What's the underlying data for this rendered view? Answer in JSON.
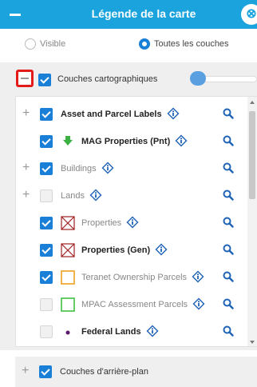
{
  "header": {
    "title": "Légende de la carte",
    "close_label": "⊗"
  },
  "radios": [
    {
      "label": "Visible",
      "selected": false
    },
    {
      "label": "Toutes les couches",
      "selected": true
    }
  ],
  "main_group": {
    "label": "Couches cartographiques",
    "checked": true
  },
  "layers": [
    {
      "label": "Asset and Parcel Labels",
      "expandable": true,
      "checked": true,
      "style": "bold",
      "symbol": "none"
    },
    {
      "label": "MAG Properties (Pnt)",
      "expandable": false,
      "checked": true,
      "style": "bold",
      "symbol": "green-pin"
    },
    {
      "label": "Buildings",
      "expandable": true,
      "checked": true,
      "style": "dim",
      "symbol": "none"
    },
    {
      "label": "Lands",
      "expandable": true,
      "checked": false,
      "style": "dim",
      "symbol": "none"
    },
    {
      "label": "Properties",
      "expandable": false,
      "checked": true,
      "style": "dim",
      "symbol": "red-cross-box"
    },
    {
      "label": "Properties (Gen)",
      "expandable": false,
      "checked": true,
      "style": "bold",
      "symbol": "red-cross-box"
    },
    {
      "label": "Teranet Ownership Parcels",
      "expandable": false,
      "checked": true,
      "style": "dim",
      "symbol": "orange-box"
    },
    {
      "label": "MPAC Assessment Parcels",
      "expandable": false,
      "checked": false,
      "style": "dim",
      "symbol": "green-box"
    },
    {
      "label": "Federal Lands",
      "expandable": false,
      "checked": false,
      "style": "bold",
      "symbol": "purple-dot"
    }
  ],
  "bottom_group": {
    "label": "Couches d'arrière-plan",
    "checked": true
  },
  "colors": {
    "header": "#1aa3dd",
    "checkbox": "#1a7fd6",
    "highlight": "#e41b1b"
  }
}
